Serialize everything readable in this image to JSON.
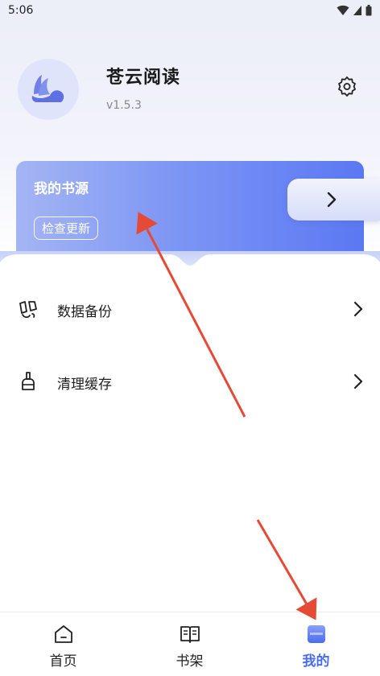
{
  "status_bar": {
    "time": "5:06",
    "icons": [
      "wifi-icon",
      "signal-icon",
      "battery-icon"
    ]
  },
  "profile": {
    "app_name": "苍云阅读",
    "version": "v1.5.3",
    "avatar_icon": "app-logo-icon",
    "settings_icon": "gear-icon"
  },
  "book_source_card": {
    "title": "我的书源",
    "check_update_label": "检查更新",
    "arrow_icon": "chevron-right-icon"
  },
  "menu": {
    "items": [
      {
        "label": "数据备份",
        "icon": "backup-icon"
      },
      {
        "label": "清理缓存",
        "icon": "broom-icon"
      }
    ]
  },
  "bottom_nav": {
    "items": [
      {
        "label": "首页",
        "icon": "home-icon",
        "active": false
      },
      {
        "label": "书架",
        "icon": "book-icon",
        "active": false
      },
      {
        "label": "我的",
        "icon": "profile-icon",
        "active": true
      }
    ]
  },
  "colors": {
    "accent": "#4a6cf0",
    "card_gradient_start": "#a4b5f3",
    "card_gradient_end": "#5b78f3",
    "annotation_arrow": "#e54a36"
  }
}
